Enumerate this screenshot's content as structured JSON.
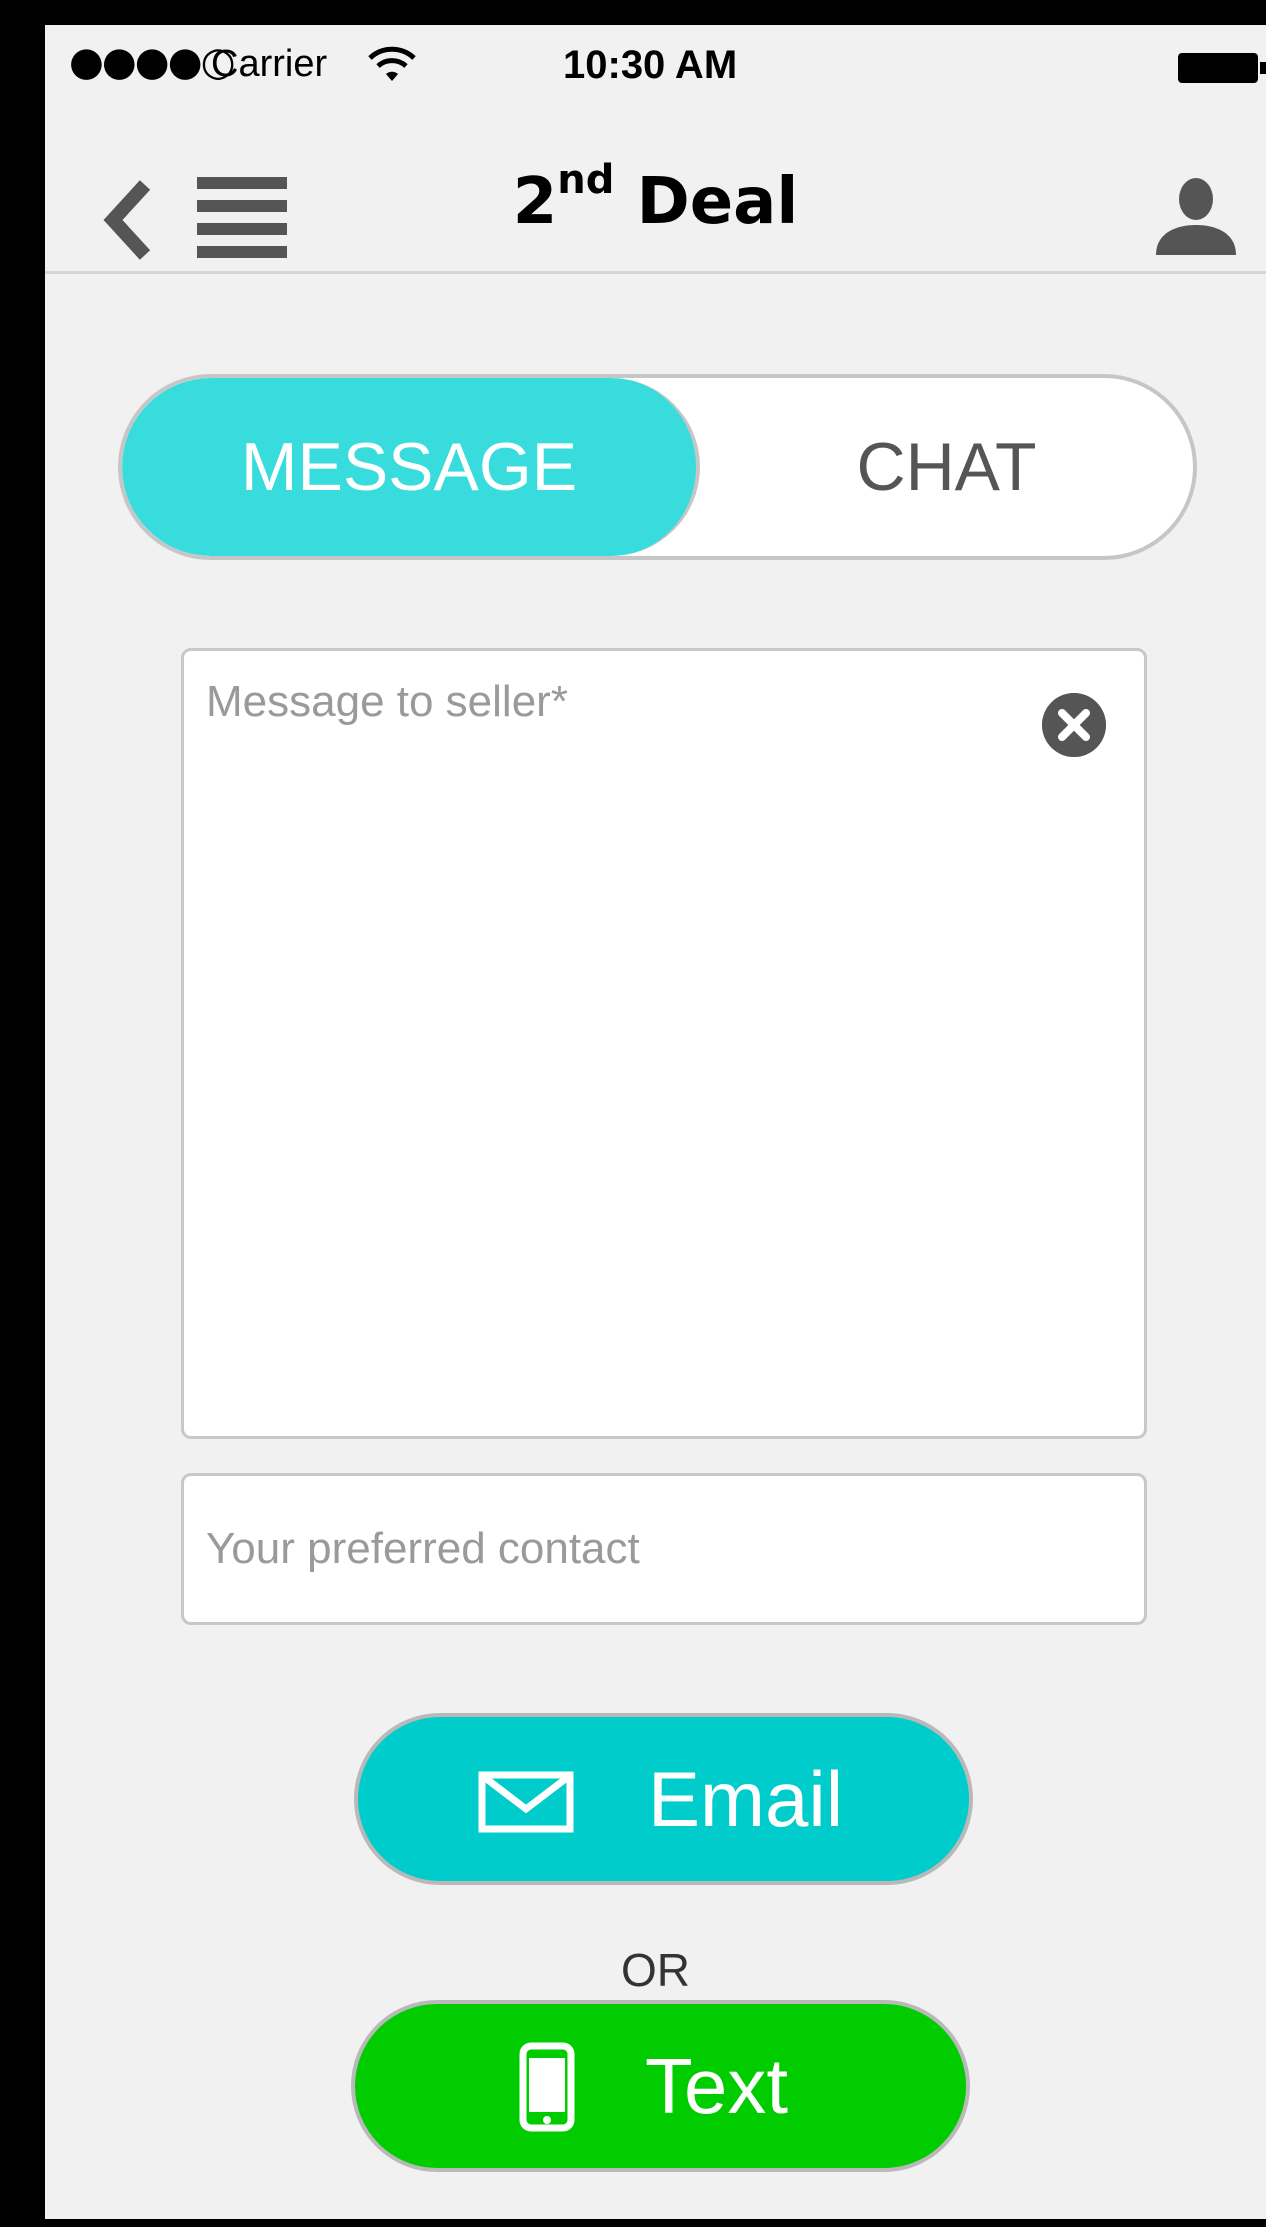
{
  "status_bar": {
    "signal": "●●●●○",
    "carrier": "Carrier",
    "time": "10:30 AM"
  },
  "nav": {
    "title_base": "2",
    "title_sup": "nd",
    "title_rest": " Deal"
  },
  "segments": {
    "message": "MESSAGE",
    "chat": "CHAT",
    "active": "MESSAGE"
  },
  "form": {
    "message_placeholder": "Message to seller*",
    "contact_placeholder": "Your preferred contact"
  },
  "actions": {
    "email": "Email",
    "or": "OR",
    "text": "Text"
  },
  "icons": [
    "wifi-icon",
    "battery-icon",
    "back-icon",
    "menu-icon",
    "user-icon",
    "clear-icon",
    "mail-icon",
    "phone-icon"
  ],
  "colors": {
    "accent": "#38dcdc",
    "email_button": "#00cccc",
    "text_button": "#00cc00",
    "background": "#f1f1f1"
  }
}
